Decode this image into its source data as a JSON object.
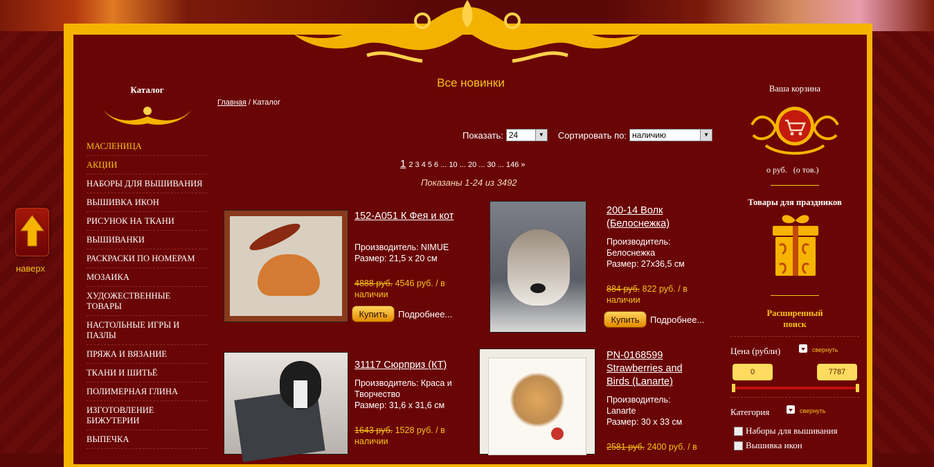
{
  "left": {
    "title": "Каталог",
    "menu": [
      {
        "label": "МАСЛЕНИЦА",
        "highlight": true
      },
      {
        "label": "АКЦИИ",
        "highlight": true
      },
      {
        "label": "НАБОРЫ ДЛЯ ВЫШИВАНИЯ",
        "highlight": false
      },
      {
        "label": "ВЫШИВКА ИКОН",
        "highlight": false
      },
      {
        "label": "РИСУНОК НА ТКАНИ",
        "highlight": false
      },
      {
        "label": "ВЫШИВАНКИ",
        "highlight": false
      },
      {
        "label": "РАСКРАСКИ ПО НОМЕРАМ",
        "highlight": false
      },
      {
        "label": "МОЗАИКА",
        "highlight": false
      },
      {
        "label": "ХУДОЖЕСТВЕННЫЕ ТОВАРЫ",
        "highlight": false
      },
      {
        "label": "НАСТОЛЬНЫЕ ИГРЫ И ПАЗЛЫ",
        "highlight": false
      },
      {
        "label": "ПРЯЖА И ВЯЗАНИЕ",
        "highlight": false
      },
      {
        "label": "ТКАНИ И ШИТЬЁ",
        "highlight": false
      },
      {
        "label": "ПОЛИМЕРНАЯ ГЛИНА",
        "highlight": false
      },
      {
        "label": "ИЗГОТОВЛЕНИЕ БИЖУТЕРИИ",
        "highlight": false
      },
      {
        "label": "ВЫПЕЧКА",
        "highlight": false
      }
    ]
  },
  "up_label": "наверх",
  "center": {
    "title": "Все новинки",
    "breadcrumb_home": "Главная",
    "breadcrumb_sep": " / ",
    "breadcrumb_current": "Каталог",
    "show_label": "Показать:",
    "show_value": "24",
    "sort_label": "Сортировать по:",
    "sort_value": "наличию",
    "pager_current": "1",
    "pager_rest": "2 3 4 5 6 ... 10 ... 20 ... 30 ... 146 »",
    "shown_text": "Показаны 1-24 из 3492",
    "buy_label": "Купить",
    "more_label": "Подробнее...",
    "products": [
      {
        "title": "152-A051 К Фея и кот",
        "maker_line": "Производитель: NIMUE",
        "size_line": "Размер: 21,5 х 20 см",
        "old_price": "4888 руб.",
        "price": "4546 руб. / в наличии"
      },
      {
        "title": "200-14 Волк (Белоснежка)",
        "maker_line": "Производитель: Белоснежка",
        "size_line": "Размер: 27х36,5 см",
        "old_price": "884 руб.",
        "price": "822 руб. / в наличии"
      },
      {
        "title": "31117 Сюрприз (КТ)",
        "maker_line": "Производитель: Краса и Творчество",
        "size_line": "Размер: 31,6 х 31,6 см",
        "old_price": "1643 руб.",
        "price": "1528 руб. / в наличии"
      },
      {
        "title": "PN-0168599 Strawberries and Birds (Lanarte)",
        "maker_line": "Производитель: Lanarte",
        "size_line": "Размер: 30 х 33 см",
        "old_price": "2581 руб.",
        "price": "2400 руб. / в"
      }
    ]
  },
  "right": {
    "cart_title": "Ваша корзина",
    "cart_sum": "о руб.",
    "cart_count": "(о тов.)",
    "holiday_title": "Товары для праздников",
    "adv_search": "Расширенный поиск",
    "price_label": "Цена (рубли)",
    "collapse_label": "свернуть",
    "price_min": "0",
    "price_max": "7787",
    "category_label": "Категория",
    "categories": [
      "Наборы для вышивания",
      "Вышивка икон"
    ]
  },
  "colors": {
    "accent": "#f6c21a",
    "frame": "#f6b400",
    "background": "#6a0505"
  }
}
